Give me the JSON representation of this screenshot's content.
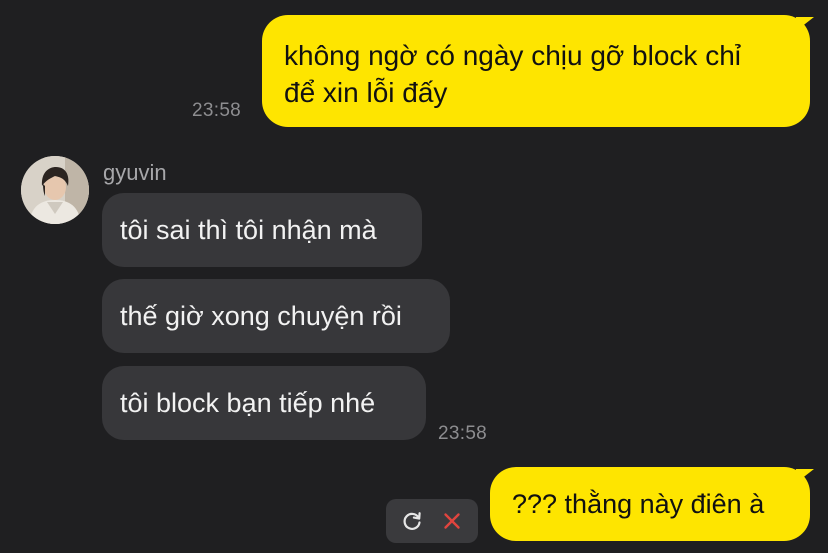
{
  "conversation": {
    "outgoing_first": {
      "lines": [
        "không ngờ có ngày chịu gỡ block chỉ",
        "để xin lỗi đấy"
      ],
      "time": "23:58"
    },
    "contact": {
      "name": "gyuvin"
    },
    "incoming": [
      {
        "text": "tôi sai thì tôi nhận mà"
      },
      {
        "text": "thế giờ xong chuyện rồi"
      },
      {
        "text": "tôi block bạn tiếp nhé"
      }
    ],
    "incoming_time": "23:58",
    "outgoing_last": {
      "text": "??? thằng này điên à"
    },
    "failed_actions": {
      "retry_icon": "refresh-icon",
      "delete_icon": "close-icon"
    }
  },
  "colors": {
    "background": "#1f1f21",
    "outgoing_bubble": "#fee500",
    "incoming_bubble": "#37373a",
    "timestamp": "#8d8d90",
    "delete_red": "#e0443e"
  }
}
